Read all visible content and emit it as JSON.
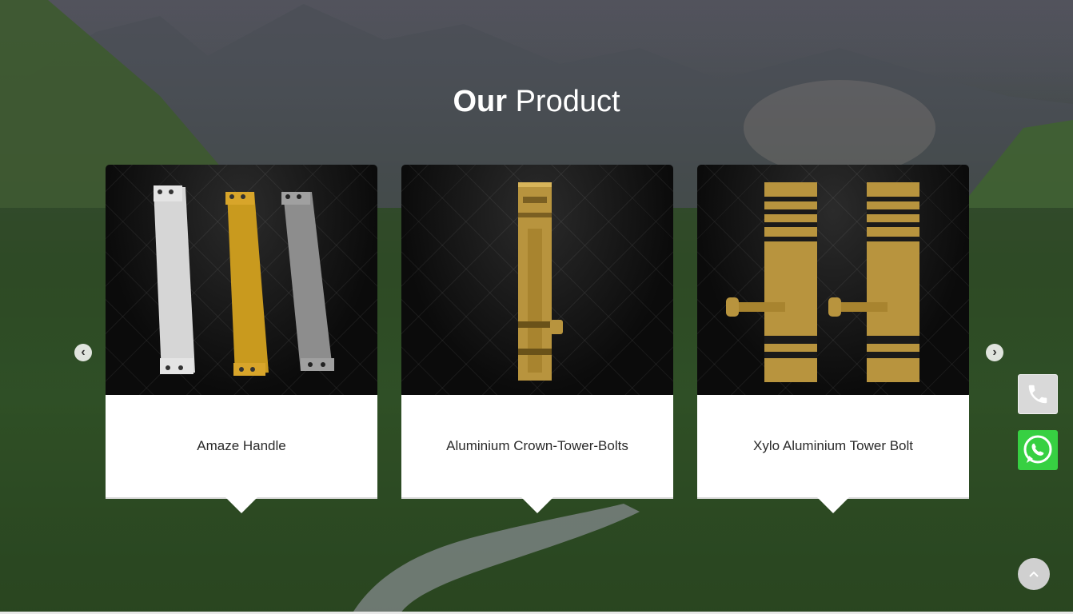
{
  "section": {
    "title_bold": "Our",
    "title_regular": "Product"
  },
  "products": [
    {
      "name": "Amaze Handle",
      "image_icon": "handle-image"
    },
    {
      "name": "Aluminium Crown-Tower-Bolts",
      "image_icon": "tower-bolt-image"
    },
    {
      "name": "Xylo Aluminium Tower Bolt",
      "image_icon": "xylo-tower-bolt-image"
    }
  ],
  "carousel": {
    "prev_icon": "‹",
    "next_icon": "›"
  },
  "floating": {
    "phone_icon": "phone-icon",
    "whatsapp_icon": "whatsapp-icon",
    "back_to_top_icon": "chevron-up-icon"
  },
  "colors": {
    "whatsapp": "#37d042",
    "card_background": "#ffffff",
    "image_background": "#0d0d0d",
    "brass": "#b8943e"
  }
}
